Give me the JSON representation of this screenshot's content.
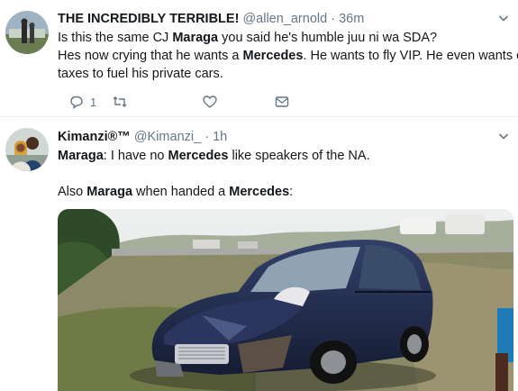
{
  "tweets": [
    {
      "display_name": "THE INCREDIBLY TERRIBLE!",
      "handle": "@allen_arnold",
      "separator": "·",
      "time": "36m",
      "lines": [
        [
          "Is this the same CJ ",
          "Maraga",
          " you said he's humble juu ni wa SDA?"
        ],
        [
          "Hes now crying that he wants a ",
          "Mercedes",
          ". He wants to fly VIP. He even wants out"
        ],
        [
          "taxes to fuel his private cars.",
          "",
          ""
        ]
      ],
      "reply_count": "1"
    },
    {
      "display_name": "Kimanzi®™",
      "handle": "@Kimanzi_",
      "separator": "·",
      "time": "1h",
      "line1": {
        "bold": "Maraga",
        "text": ": I have no ",
        "bold2": "Mercedes",
        "text2": " like speakers of the NA."
      },
      "line2": {
        "text": "Also ",
        "bold": "Maraga",
        "text2": " when handed a ",
        "bold2": "Mercedes",
        "text3": ":"
      }
    }
  ],
  "icons": [
    "reply-icon",
    "retweet-icon",
    "like-icon",
    "dm-icon",
    "chevron-down-icon"
  ],
  "colors": {
    "secondary_text": "#657786",
    "border": "#e6ecf0",
    "car": "#1b2440"
  }
}
